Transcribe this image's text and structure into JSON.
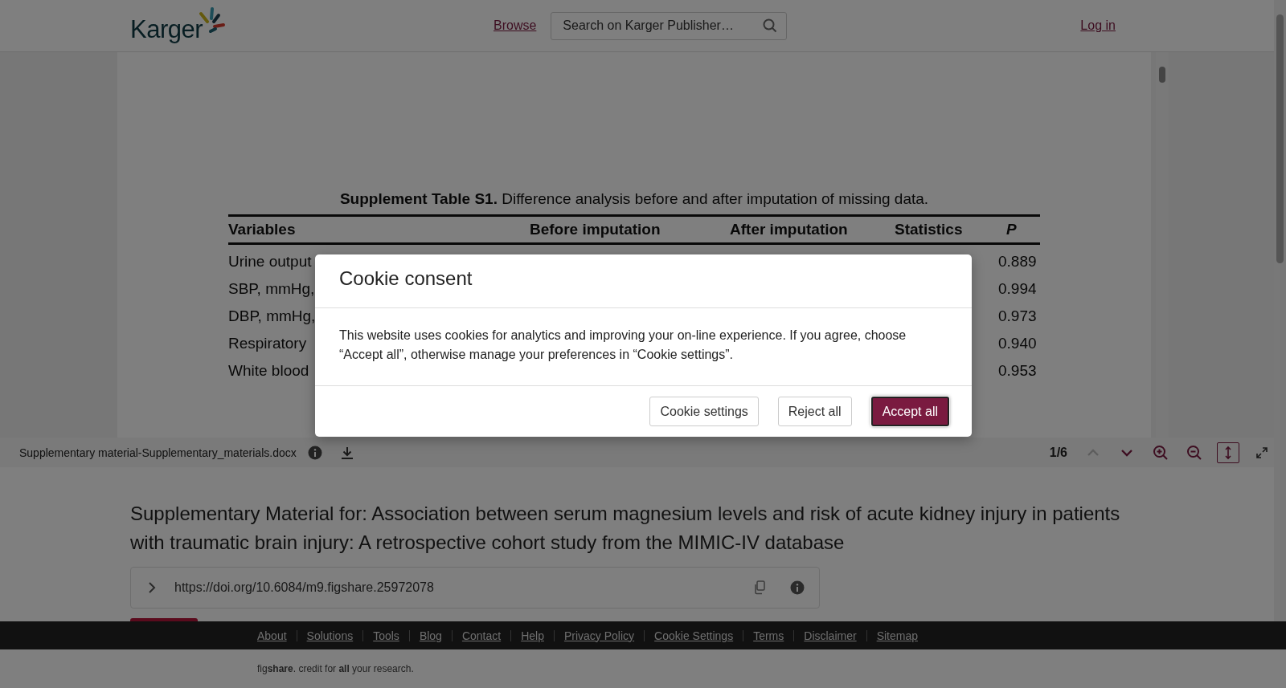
{
  "header": {
    "logo": "Karger",
    "nav_link": "Browse",
    "search": {
      "placeholder": "Search on Karger Publisher…"
    },
    "login_link": "Log in"
  },
  "viewer": {
    "document": {
      "caption_bold": "Supplement Table S1.",
      "caption": "Difference analysis before and after imputation of missing data.",
      "columns": [
        "Variables",
        "Before imputation",
        "After imputation",
        "Statistics",
        "P"
      ],
      "rows": [
        {
          "variable": "Urine output",
          "p": "0.889"
        },
        {
          "variable": "SBP, mmHg,",
          "p": "0.994"
        },
        {
          "variable": "DBP, mmHg,",
          "p": "0.973"
        },
        {
          "variable": "Respiratory",
          "p": "0.940"
        },
        {
          "variable": "White blood",
          "p": "0.953"
        }
      ]
    },
    "toolbar": {
      "filename": "Supplementary material-Supplementary_materials.docx",
      "page": "1/6",
      "controls": [
        {
          "kind": "up",
          "disabled": true,
          "selected": false
        },
        {
          "kind": "down",
          "disabled": false,
          "selected": false
        },
        {
          "kind": "zoom-in",
          "disabled": false,
          "selected": false
        },
        {
          "kind": "zoom-out",
          "disabled": false,
          "selected": false
        },
        {
          "kind": "fit",
          "disabled": false,
          "selected": true
        },
        {
          "kind": "fullscreen",
          "disabled": false,
          "selected": false
        }
      ]
    }
  },
  "item": {
    "title": "Supplementary Material for: Association between serum magnesium levels and risk of acute kidney injury in patients with traumatic brain injury: A retrospective cohort study from the MIMIC-IV database",
    "doi": "https://doi.org/10.6084/m9.figshare.25972078"
  },
  "footer": {
    "links": [
      "About",
      "Solutions",
      "Tools",
      "Blog",
      "Contact",
      "Help",
      "Privacy Policy",
      "Cookie Settings",
      "Terms",
      "Disclaimer",
      "Sitemap"
    ],
    "tagline": "fig**share**. credit for **all** your research."
  },
  "cookie_dialog": {
    "title": "Cookie consent",
    "text": "This website uses cookies for analytics and improving your on-line experience. If you agree, choose “Accept all”, otherwise manage your preferences in “Cookie settings”.",
    "buttons": [
      {
        "label": "Cookie settings",
        "kind": "secondary"
      },
      {
        "label": "Reject all",
        "kind": "secondary"
      },
      {
        "label": "Accept all",
        "kind": "primary"
      }
    ]
  }
}
